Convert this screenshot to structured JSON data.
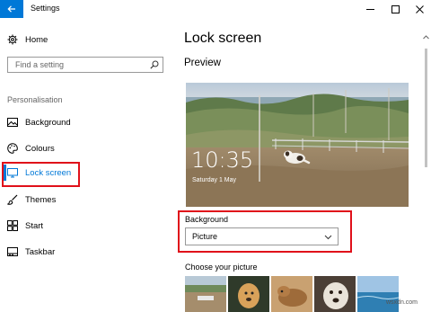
{
  "window": {
    "title": "Settings"
  },
  "sidebar": {
    "home_label": "Home",
    "search_placeholder": "Find a setting",
    "section_label": "Personalisation",
    "items": [
      {
        "label": "Background",
        "icon": "image-icon"
      },
      {
        "label": "Colours",
        "icon": "palette-icon"
      },
      {
        "label": "Lock screen",
        "icon": "monitor-icon",
        "active": true
      },
      {
        "label": "Themes",
        "icon": "brush-icon"
      },
      {
        "label": "Start",
        "icon": "start-icon"
      },
      {
        "label": "Taskbar",
        "icon": "taskbar-icon"
      }
    ]
  },
  "main": {
    "title": "Lock screen",
    "preview_heading": "Preview",
    "preview": {
      "time": "10:35",
      "date": "Saturday 1 May"
    },
    "background_label": "Background",
    "background_value": "Picture",
    "choose_label": "Choose your picture",
    "thumbnails": [
      "beach",
      "dog",
      "dog-lying",
      "dog-closeup",
      "sea"
    ]
  },
  "watermark": "wsxdn.com",
  "colors": {
    "accent": "#0078d7",
    "highlight": "#e0101a"
  }
}
